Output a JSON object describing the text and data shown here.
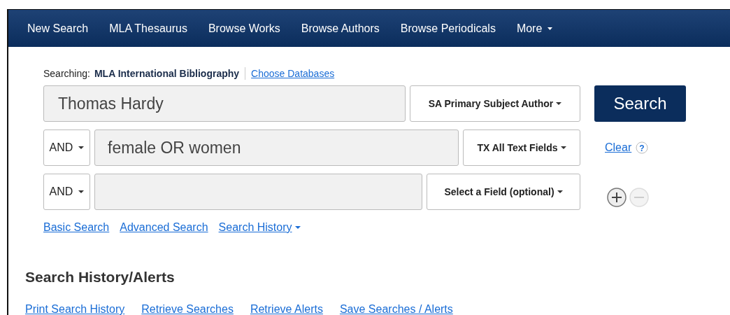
{
  "nav": {
    "items": [
      "New Search",
      "MLA Thesaurus",
      "Browse Works",
      "Browse Authors",
      "Browse Periodicals"
    ],
    "more": "More"
  },
  "searching": {
    "label": "Searching:",
    "database": "MLA International Bibliography",
    "link": "Choose Databases"
  },
  "rows": [
    {
      "operator": null,
      "value": "Thomas Hardy",
      "field": "SA Primary Subject Author"
    },
    {
      "operator": "AND",
      "value": "female OR women",
      "field": "TX All Text Fields"
    },
    {
      "operator": "AND",
      "value": null,
      "field": "Select a Field (optional)"
    }
  ],
  "search_button": "Search",
  "clear": "Clear",
  "help": "?",
  "add_row": {
    "disabled": false
  },
  "remove_row": {
    "disabled": true
  },
  "links": [
    "Basic Search",
    "Advanced Search"
  ],
  "history_link": "Search History",
  "history": {
    "title": "Search History/Alerts",
    "links": [
      "Print Search History",
      "Retrieve Searches",
      "Retrieve Alerts",
      "Save Searches / Alerts"
    ]
  }
}
